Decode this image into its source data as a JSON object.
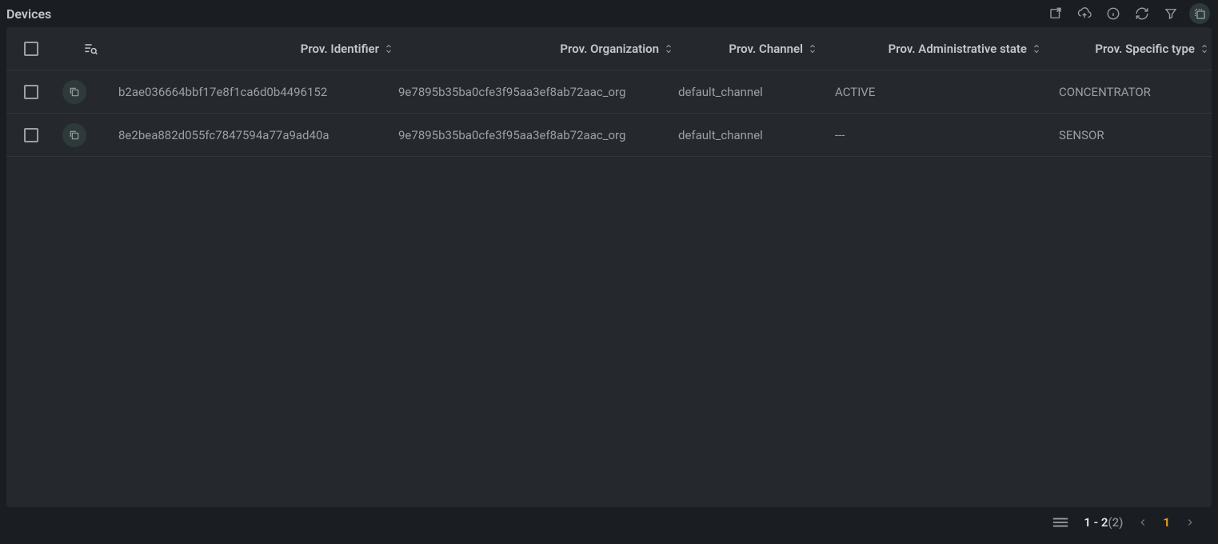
{
  "page": {
    "title": "Devices"
  },
  "columns": {
    "identifier": "Prov. Identifier",
    "organization": "Prov. Organization",
    "channel": "Prov. Channel",
    "admin_state": "Prov. Administrative state",
    "specific_type": "Prov. Specific type"
  },
  "rows": [
    {
      "identifier": "b2ae036664bbf17e8f1ca6d0b4496152",
      "organization": "9e7895b35ba0cfe3f95aa3ef8ab72aac_org",
      "channel": "default_channel",
      "admin_state": "ACTIVE",
      "specific_type": "CONCENTRATOR"
    },
    {
      "identifier": "8e2bea882d055fc7847594a77a9ad40a",
      "organization": "9e7895b35ba0cfe3f95aa3ef8ab72aac_org",
      "channel": "default_channel",
      "admin_state": "---",
      "specific_type": "SENSOR"
    }
  ],
  "pagination": {
    "range": "1 - 2",
    "total": "(2)",
    "current_page": "1"
  }
}
